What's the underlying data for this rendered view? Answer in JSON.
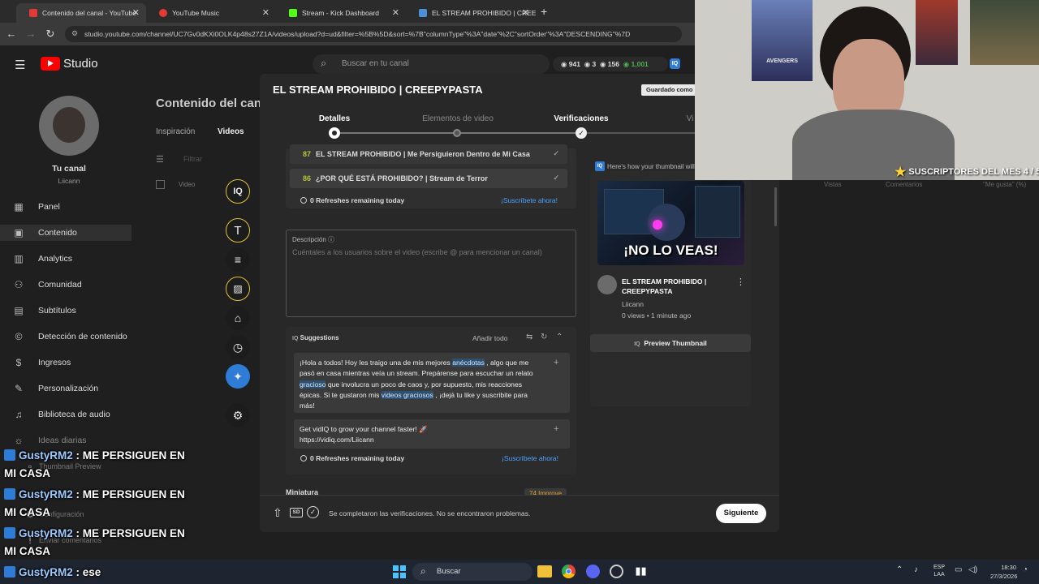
{
  "browser": {
    "tabs": [
      {
        "label": "Contenido del canal - YouTube",
        "active": true,
        "color": "#e53935"
      },
      {
        "label": "YouTube Music",
        "active": false,
        "color": "#e53935"
      },
      {
        "label": "Stream - Kick Dashboard",
        "active": false,
        "color": "#53fc18"
      },
      {
        "label": "EL STREAM PROHIBIDO | CREEPYP",
        "active": false,
        "color": "#4a8fd8"
      }
    ],
    "url": "studio.youtube.com/channel/UC7Gv0dKXi0OLK4p48s27Z1A/videos/upload?d=ud&filter=%5B%5D&sort=%7B\"columnType\"%3A\"date\"%2C\"sortOrder\"%3A\"DESCENDING\"%7D"
  },
  "studio": {
    "logo": "Studio",
    "search_placeholder": "Buscar en tu canal",
    "stats": {
      "views": "941",
      "comments": "3",
      "likes": "156",
      "subs": "1,001"
    },
    "channel_label": "Tu canal",
    "channel_name": "Liicann",
    "page_title": "Contenido del canal",
    "tabs": [
      "Inspiración",
      "Videos"
    ],
    "filter_label": "Filtrar",
    "table_col_video": "Video",
    "table_cols_right": [
      "Vistas",
      "Comentarios",
      "\"Me gusta\" (%)"
    ],
    "sidebar": [
      {
        "label": "Panel",
        "icon": "dashboard-icon"
      },
      {
        "label": "Contenido",
        "icon": "content-icon"
      },
      {
        "label": "Analytics",
        "icon": "analytics-icon"
      },
      {
        "label": "Comunidad",
        "icon": "community-icon"
      },
      {
        "label": "Subtítulos",
        "icon": "subtitles-icon"
      },
      {
        "label": "Detección de contenido",
        "icon": "copyright-icon"
      },
      {
        "label": "Ingresos",
        "icon": "money-icon"
      },
      {
        "label": "Personalización",
        "icon": "customize-icon"
      },
      {
        "label": "Biblioteca de audio",
        "icon": "audio-library-icon"
      },
      {
        "label": "Ideas diarias",
        "icon": "ideas-icon"
      },
      {
        "label": "Thumbnail Preview",
        "icon": "thumbnail-icon"
      },
      {
        "label": "Configuración",
        "icon": "settings-icon"
      },
      {
        "label": "Enviar comentarios",
        "icon": "feedback-icon"
      }
    ]
  },
  "modal": {
    "title": "EL STREAM PROHIBIDO | CREEPYPASTA",
    "saved_badge": "Guardado como p",
    "steps": [
      "Detalles",
      "Elementos de video",
      "Verificaciones",
      "Vi"
    ],
    "title_suggestions": [
      {
        "score": "87",
        "text": "EL STREAM PROHIBIDO | Me Persiguieron Dentro de Mi Casa"
      },
      {
        "score": "86",
        "text": "¿POR QUÉ ESTÁ PROHIBIDO? | Stream de Terror"
      }
    ],
    "refreshes": "0 Refreshes remaining today",
    "subscribe_cta": "¡Suscríbete ahora!",
    "description_label": "Descripción",
    "description_placeholder": "Cuéntales a los usuarios sobre el video (escribe @ para mencionar un canal)",
    "suggestions_title": "Suggestions",
    "add_all": "Añadir todo",
    "suggestion_1": {
      "p1": "¡Hola a todos! Hoy les traigo una de mis mejores ",
      "h1": "anécdotas",
      "p2": " , algo que me pasó en casa mientras veía un stream. Prepárense para escuchar un relato ",
      "h2": "gracioso",
      "p3": " que involucra un poco de caos y, por supuesto, mis reacciones épicas. Si te gustaron mis ",
      "h3": "videos graciosos",
      "p4": " , ¡dejá tu like y suscribite para más!"
    },
    "suggestion_2": {
      "line1": "Get vidIQ to grow your channel faster! 🚀",
      "line2": "https://vidiq.com/Liicann"
    },
    "thumbnail_section": "Miniatura",
    "improve_badge": "Improve",
    "improve_score": "74",
    "footer_status": "Se completaron las verificaciones. No se encontraron problemas.",
    "next_button": "Siguiente",
    "preview": {
      "hint": "Here's how your thumbnail will",
      "thumb_text": "¡NO LO VEAS!",
      "video_title": "EL STREAM PROHIBIDO | CREEPYPASTA",
      "channel": "Liicann",
      "meta": "0 views • 1 minute ago",
      "preview_button": "Preview Thumbnail"
    }
  },
  "overlay": {
    "webcam_banner": "SUSCRIPTORES DEL MES 4 / 5",
    "webcam_poster": "AVENGERS",
    "chat": [
      {
        "user": "GustyRM2",
        "message": ": ME PERSIGUEN EN MI CASA"
      },
      {
        "user": "GustyRM2",
        "message": ": ME PERSIGUEN EN MI CASA"
      },
      {
        "user": "GustyRM2",
        "message": ": ME PERSIGUEN EN MI CASA"
      },
      {
        "user": "GustyRM2",
        "message": ": ese"
      }
    ]
  },
  "taskbar": {
    "search": "Buscar",
    "lang": "ESP",
    "lang2": "LAA",
    "time": "18:30",
    "date": "27/3/2026"
  },
  "colors": {
    "accent": "#2f7cd6",
    "score": "#b8c43a",
    "link": "#4da3ff",
    "yt_red": "#ff0000"
  }
}
